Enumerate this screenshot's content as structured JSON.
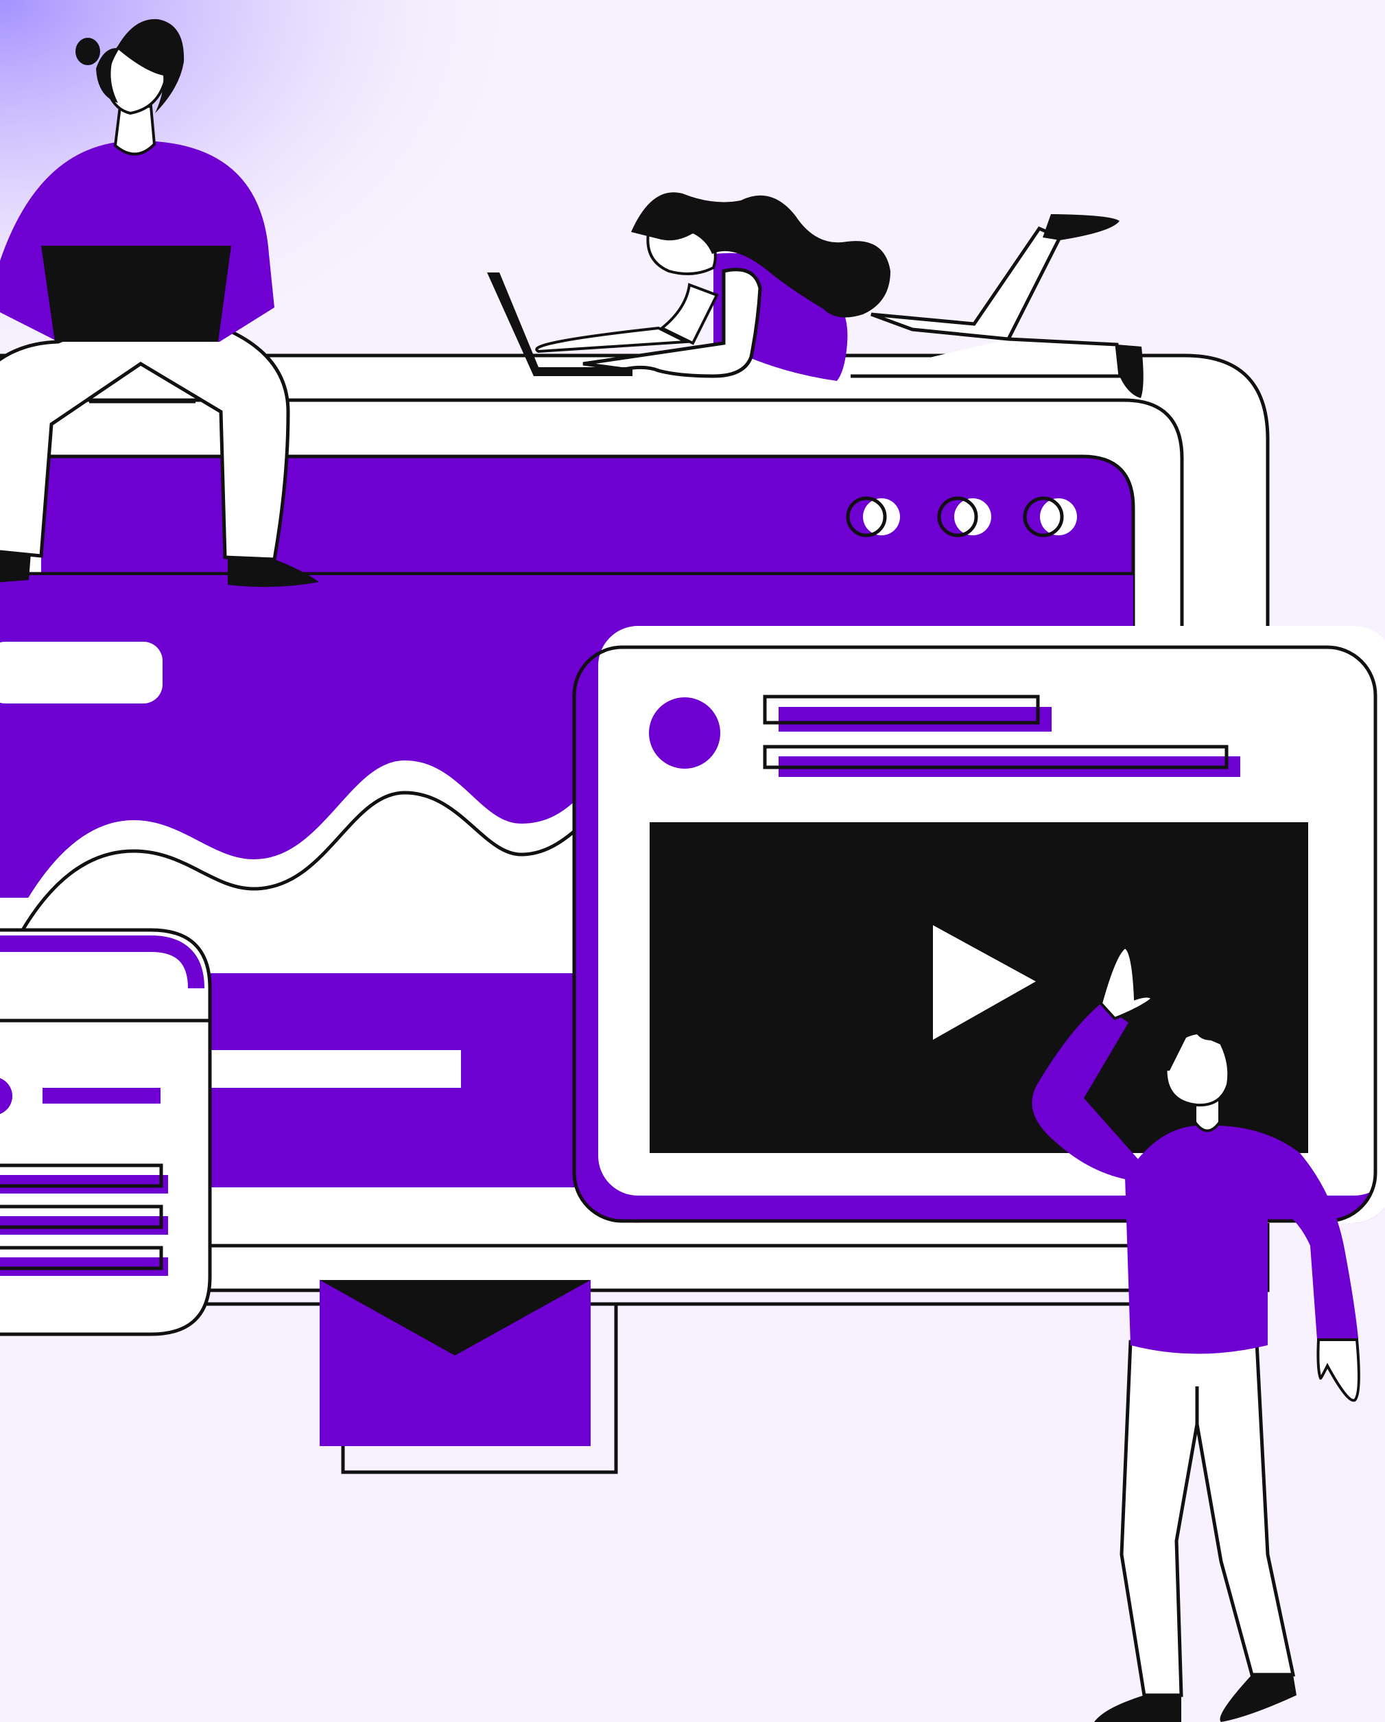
{
  "illustration": {
    "colors": {
      "background": "#f7f2fd",
      "accent": "#6e00d2",
      "glow": "#b8a4ff",
      "ink": "#111111",
      "paper": "#ffffff"
    },
    "icons": {
      "play": "play-icon",
      "envelope": "envelope-icon",
      "window_controls": "window-control-dots"
    },
    "people": [
      "person-sitting-with-laptop",
      "person-lying-with-laptop",
      "person-reaching-to-screen"
    ]
  }
}
